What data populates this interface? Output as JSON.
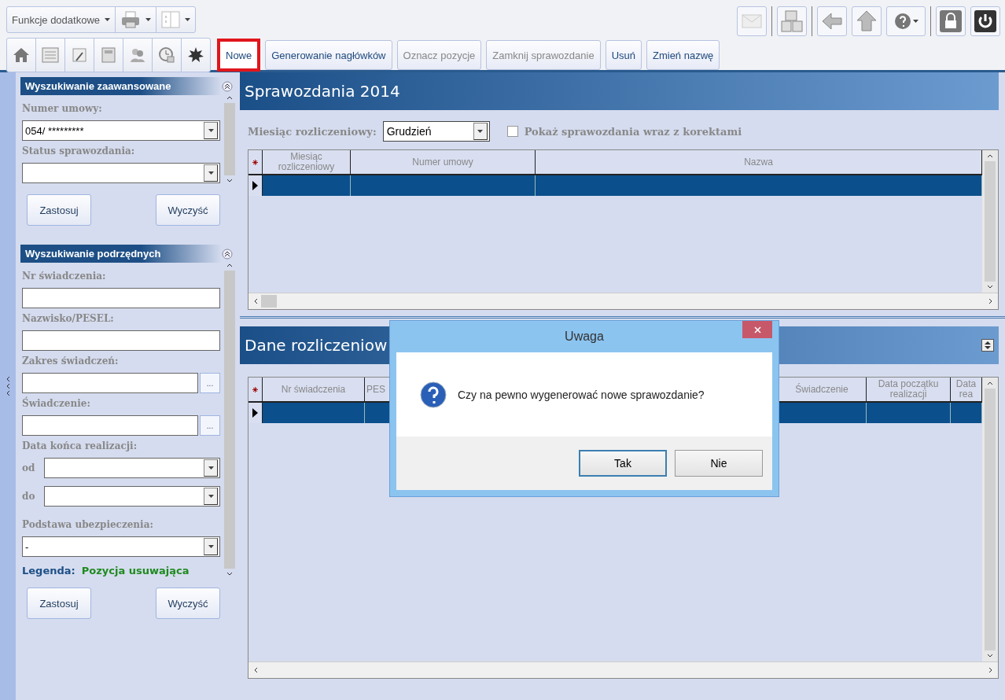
{
  "toolbar": {
    "menu_button": "Funkcje dodatkowe",
    "actions": [
      {
        "label": "Nowe",
        "highlighted": true,
        "disabled": false
      },
      {
        "label": "Generowanie nagłówków",
        "highlighted": false,
        "disabled": false
      },
      {
        "label": "Oznacz pozycje",
        "highlighted": false,
        "disabled": true
      },
      {
        "label": "Zamknij sprawozdanie",
        "highlighted": false,
        "disabled": true
      },
      {
        "label": "Usuń",
        "highlighted": false,
        "disabled": false
      },
      {
        "label": "Zmień nazwę",
        "highlighted": false,
        "disabled": false
      }
    ]
  },
  "sidebar": {
    "panels": [
      {
        "title": "Wyszukiwanie zaawansowane",
        "fields": [
          {
            "kind": "select",
            "label": "Numer umowy:",
            "value": "054/ *********"
          },
          {
            "kind": "select",
            "label": "Status sprawozdania:"
          }
        ],
        "buttons": [
          "Zastosuj",
          "Wyczyść"
        ]
      },
      {
        "title": "Wyszukiwanie podrzędnych",
        "fields": [
          {
            "kind": "text",
            "label": "Nr świadczenia:"
          },
          {
            "kind": "text",
            "label": "Nazwisko/PESEL:"
          },
          {
            "kind": "picker",
            "label": "Zakres świadczeń:",
            "button": "..."
          },
          {
            "kind": "picker",
            "label": "Świadczenie:",
            "button": "..."
          },
          {
            "kind": "range",
            "label": "Data końca realizacji:",
            "rows": [
              "od",
              "do"
            ]
          },
          {
            "kind": "select",
            "label": "Podstawa ubezpieczenia:",
            "value": "-"
          }
        ],
        "legend": {
          "label": "Legenda:",
          "value": "Pozycja usuwająca"
        },
        "buttons": [
          "Zastosuj",
          "Wyczyść"
        ]
      }
    ]
  },
  "reports": {
    "title": "Sprawozdania 2014",
    "filter_label": "Miesiąc rozliczeniowy:",
    "month": "Grudzień",
    "checkbox": {
      "label": "Pokaż sprawozdania wraz z korektami",
      "checked": false
    },
    "columns": [
      "Miesiąc rozliczeniowy",
      "Numer umowy",
      "Nazwa"
    ]
  },
  "details": {
    "title": "Dane rozliczeniow",
    "columns": [
      "Nr świadczenia",
      "PES",
      "Świadczenie",
      "Data początku realizacji",
      "Data rea"
    ]
  },
  "dialog": {
    "title": "Uwaga",
    "message": "Czy na pewno wygenerować nowe sprawozdanie?",
    "buttons": [
      "Tak",
      "Nie"
    ]
  }
}
